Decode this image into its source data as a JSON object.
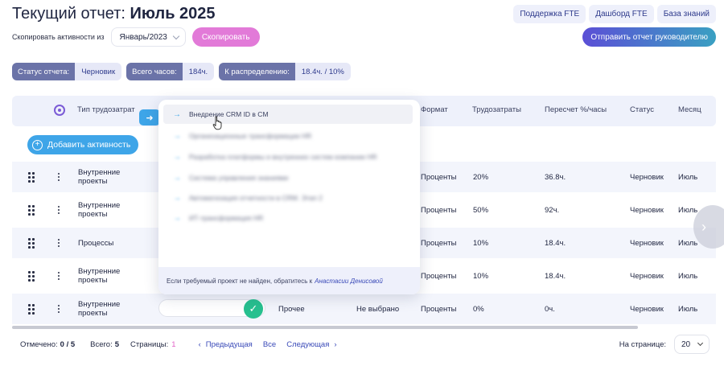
{
  "header": {
    "title_prefix": "Текущий отчет: ",
    "title_month": "Июль 2025",
    "links": [
      "Поддержка FTE",
      "Дашборд FTE",
      "База знаний"
    ],
    "copy_label": "Скопировать активности из",
    "copy_month": "Январь/2023",
    "copy_button": "Скопировать",
    "send_button": "Отправить отчет руководителю"
  },
  "stats": {
    "status_label": "Статус отчета:",
    "status_value": "Черновик",
    "hours_label": "Всего часов:",
    "hours_value": "184ч.",
    "distribute_label": "К распределению:",
    "distribute_value": "18.4ч. / 10%"
  },
  "table": {
    "columns": {
      "type": "Тип трудозатрат",
      "format": "Формат",
      "effort": "Трудозатраты",
      "recalc": "Пересчет %/часы",
      "status": "Статус",
      "month": "Месяц"
    },
    "add_button": "Добавить активность",
    "rows": [
      {
        "type": "Внутренние проекты",
        "format": "Проценты",
        "effort": "20%",
        "recalc": "36.8ч.",
        "status": "Черновик",
        "month": "Июль"
      },
      {
        "type": "Внутренние проекты",
        "format": "Проценты",
        "effort": "50%",
        "recalc": "92ч.",
        "status": "Черновик",
        "month": "Июль"
      },
      {
        "type": "Процессы",
        "format": "Проценты",
        "effort": "10%",
        "recalc": "18.4ч.",
        "status": "Черновик",
        "month": "Июль"
      },
      {
        "type": "Внутренние проекты",
        "format": "Проценты",
        "effort": "10%",
        "recalc": "18.4ч.",
        "status": "Черновик",
        "month": "Июль"
      },
      {
        "type": "Внутренние проекты",
        "project": "Прочее",
        "category": "Не выбрано",
        "format": "Проценты",
        "effort": "0%",
        "recalc": "0ч.",
        "status": "Черновик",
        "month": "Июль"
      }
    ]
  },
  "dropdown": {
    "items": [
      "Внедрение CRM ID в CM",
      "Организационные трансформации HR",
      "Разработка платформы и внутренних систем компании HR",
      "Система управления знаниями",
      "Автоматизация отчетности в CRM. Этап 2",
      "ИТ-трансформация HR"
    ],
    "footer_text": "Если требуемый проект не найден, обратитесь к",
    "footer_name": "Анастасии Денисовой"
  },
  "footer": {
    "selected_label": "Отмечено:",
    "selected_value": "0 / 5",
    "total_label": "Всего:",
    "total_value": "5",
    "pages_label": "Страницы:",
    "pages_value": "1",
    "prev": "Предыдущая",
    "all": "Все",
    "next": "Следующая",
    "per_page_label": "На странице:",
    "per_page_value": "20"
  }
}
